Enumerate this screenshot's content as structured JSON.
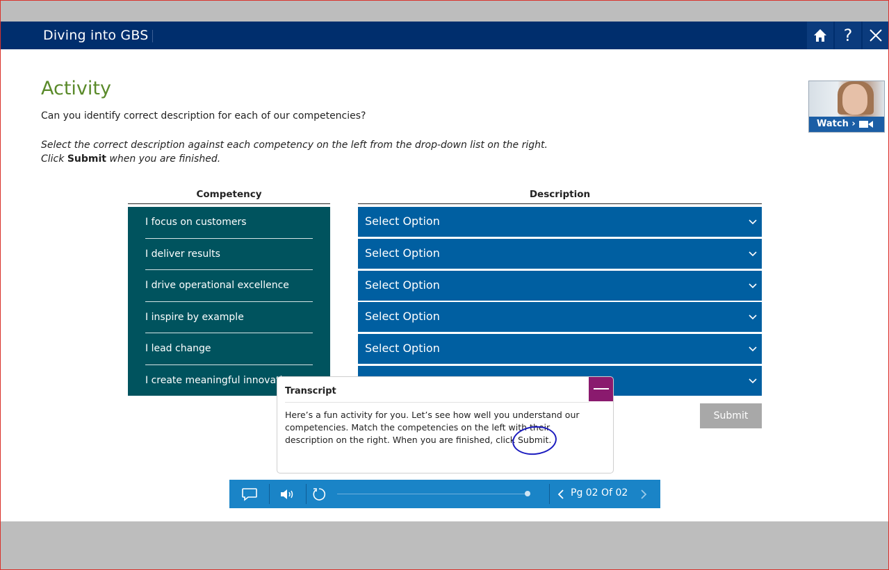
{
  "header": {
    "title": "Diving into GBS"
  },
  "page": {
    "heading": "Activity",
    "question": "Can you identify correct description for each of our competencies?",
    "instruction_line1": "Select the correct description against each competency on the left from the drop-down list on the right.",
    "instruction_line2_prefix": "Click ",
    "instruction_line2_bold": "Submit",
    "instruction_line2_suffix": " when you are finished."
  },
  "table": {
    "competency_header": "Competency",
    "description_header": "Description",
    "competencies": [
      "I focus on customers",
      "I deliver results",
      "I drive operational excellence",
      "I inspire by example",
      "I lead change",
      "I create meaningful innovation"
    ],
    "dropdowns": [
      "Select Option",
      "Select Option",
      "Select Option",
      "Select Option",
      "Select Option",
      ""
    ]
  },
  "watch": {
    "label": "Watch ›"
  },
  "submit_label": "Submit",
  "transcript": {
    "title": "Transcript",
    "body": "Here’s a fun activity for you. Let’s see how well you understand our competencies. Match the competencies on the left with their description on the right. When you are finished, click Submit."
  },
  "player": {
    "page_indicator": "Pg 02 Of 02",
    "progress": 1.0
  },
  "colors": {
    "header_bg": "#002e6d",
    "heading": "#5a8a2a",
    "competency_panel": "#00535e",
    "dropdown": "#005fa1",
    "control_bar": "#1a84c7",
    "transcript_minimize": "#8a1a6e",
    "submit_disabled": "#a8a8a8"
  }
}
